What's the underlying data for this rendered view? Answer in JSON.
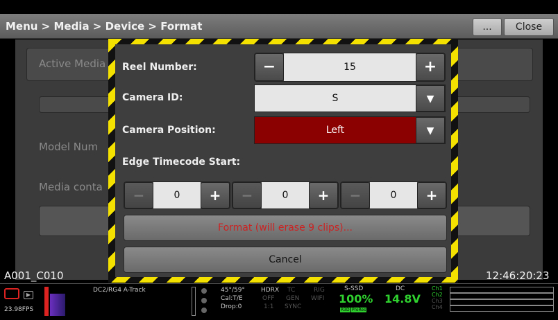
{
  "header": {
    "breadcrumb": "Menu > Media > Device > Format",
    "more_label": "...",
    "close_label": "Close"
  },
  "background": {
    "active_media_label": "Active Media",
    "model_number_label": "Model Num",
    "media_contents_label": "Media conta"
  },
  "dialog": {
    "reel_number_label": "Reel Number:",
    "reel_number_value": "15",
    "camera_id_label": "Camera ID:",
    "camera_id_value": "S",
    "camera_position_label": "Camera Position:",
    "camera_position_value": "Left",
    "edge_timecode_label": "Edge Timecode Start:",
    "timecode_values": [
      "0",
      "0",
      "0"
    ],
    "format_label": "Format (will erase 9 clips)...",
    "cancel_label": "Cancel",
    "minus": "−",
    "plus": "+",
    "arrow": "▼"
  },
  "timeline": {
    "clip_name": "A001_C010",
    "timecode": "12:46:20:23"
  },
  "status": {
    "fps": "23.98FPS",
    "track": "DC2/RG4  A-Track",
    "shutter": "45°/59°",
    "cal": "Cal:T/E",
    "drop": "Drop:0",
    "codec": "HDRX",
    "codec_off": "OFF",
    "codec_ratio": "1:1",
    "tc": "TC",
    "tc_gen": "GEN",
    "tc_sync": "SYNC",
    "rig": "RIG",
    "rig_wifi": "WIFI",
    "media_label": "S-SSD",
    "media_percent": "100%",
    "media_badge_1": "R3D",
    "media_badge_2": "ProRes",
    "power_label": "DC",
    "power_value": "14.8V",
    "channels": [
      "Ch1",
      "Ch2",
      "Ch3",
      "Ch4"
    ]
  },
  "colors": {
    "accent_red": "#8b0000",
    "warning_yellow": "#f5e100",
    "status_green": "#2fd12f",
    "format_text": "#cc2222"
  }
}
